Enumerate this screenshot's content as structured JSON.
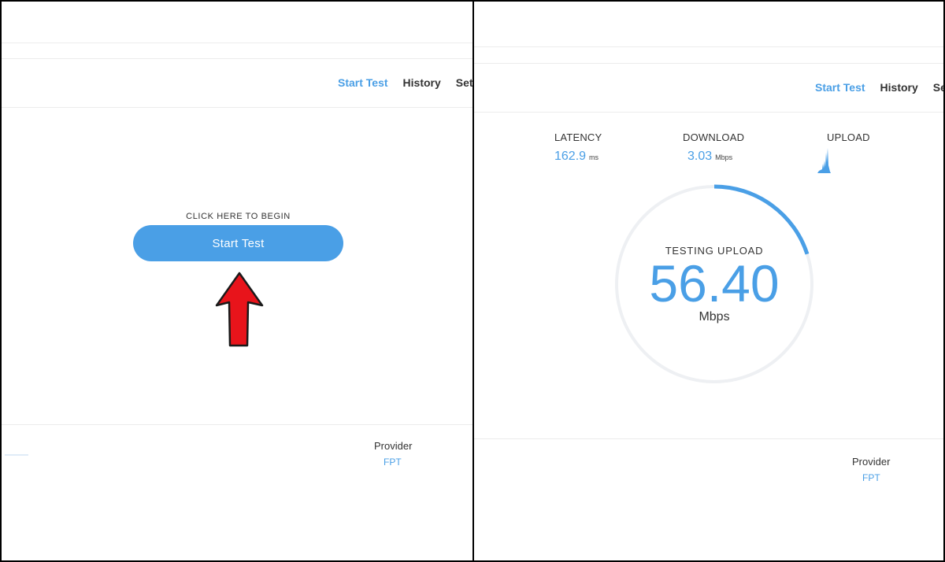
{
  "colors": {
    "accent": "#4a9fe6",
    "arrow": "#e8141b",
    "text": "#333333",
    "ring": "#eef0f3"
  },
  "left": {
    "nav": [
      {
        "label": "Start Test",
        "active": true
      },
      {
        "label": "History",
        "active": false
      },
      {
        "label": "Sett",
        "active": false
      }
    ],
    "begin_caption": "CLICK HERE TO BEGIN",
    "start_button": "Start Test",
    "provider_label": "Provider",
    "provider_value": "FPT",
    "arrow_icon": "red-up-arrow-icon"
  },
  "right": {
    "nav": [
      {
        "label": "Start Test",
        "active": true
      },
      {
        "label": "History",
        "active": false
      },
      {
        "label": "Se",
        "active": false
      }
    ],
    "latency": {
      "label": "LATENCY",
      "value": "162.9",
      "unit": "ms"
    },
    "download": {
      "label": "DOWNLOAD",
      "value": "3.03",
      "unit": "Mbps"
    },
    "upload": {
      "label": "UPLOAD",
      "icon": "upload-spark-icon"
    },
    "gauge": {
      "status": "TESTING UPLOAD",
      "value": "56.40",
      "unit": "Mbps",
      "progress_fraction": 0.2
    },
    "provider_label": "Provider",
    "provider_value": "FPT"
  }
}
